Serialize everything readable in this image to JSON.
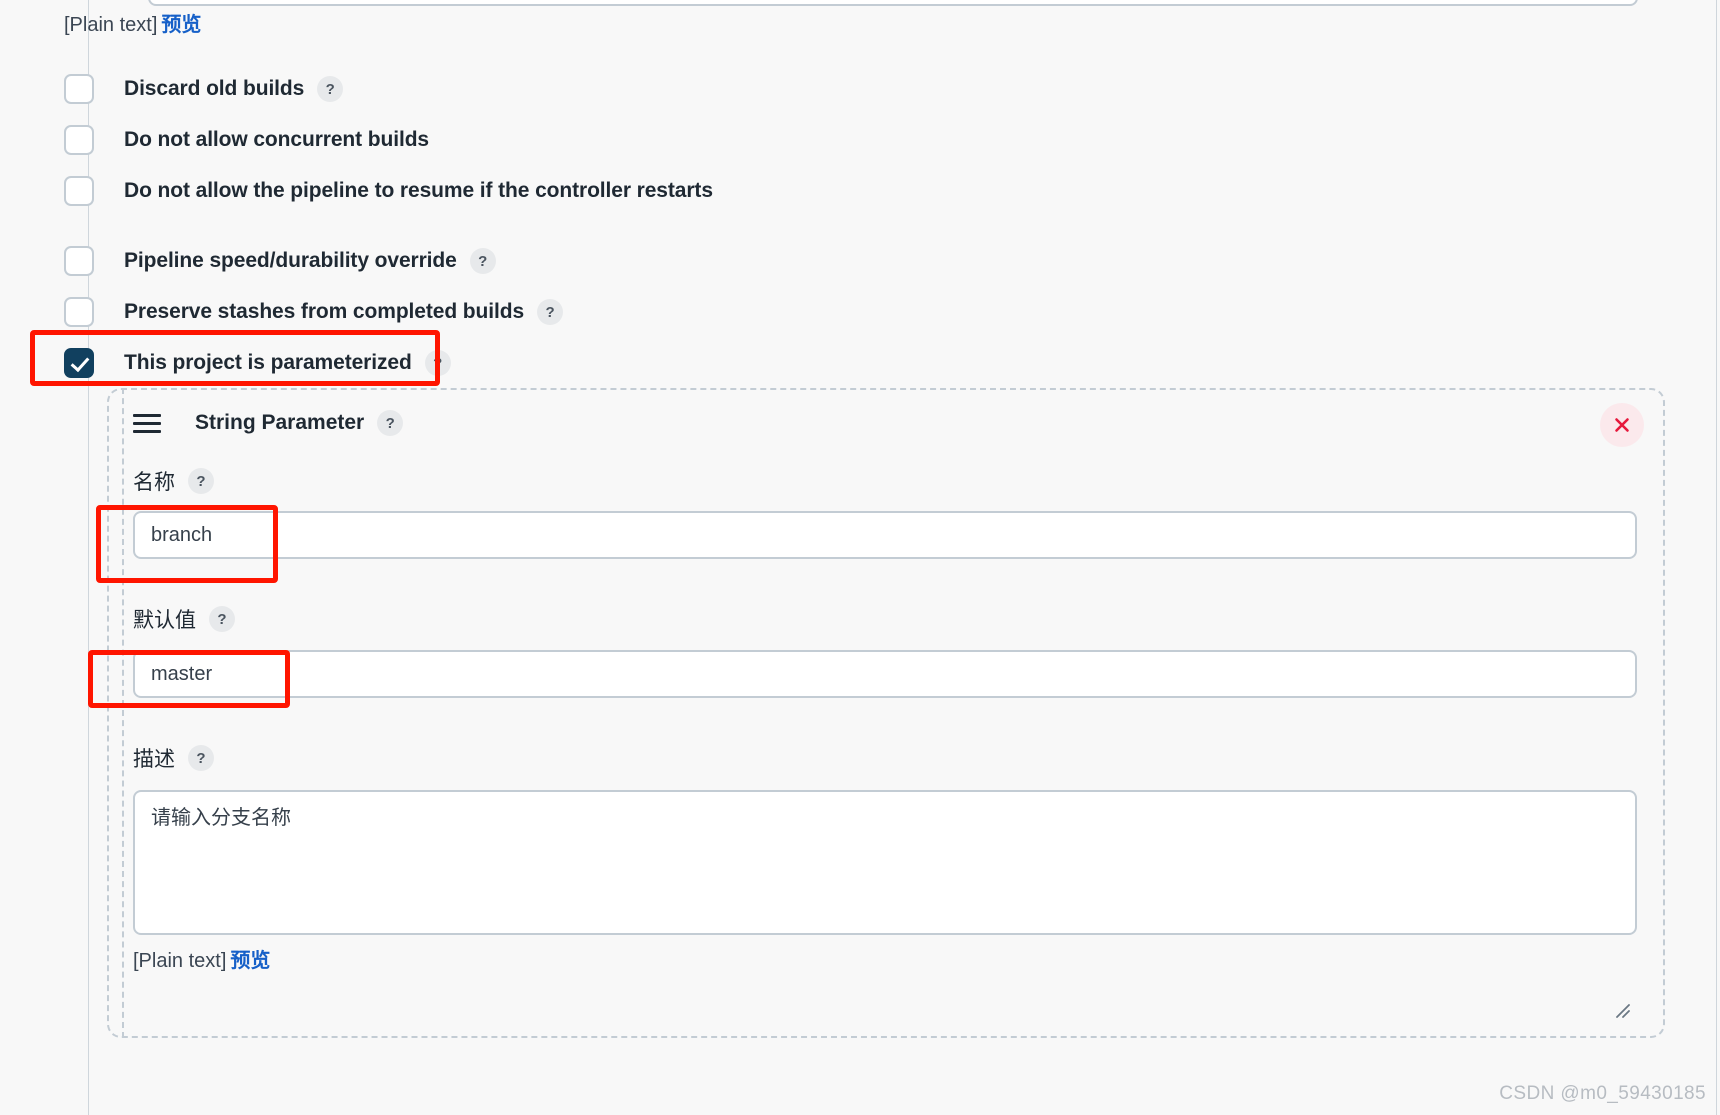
{
  "page": {
    "background_color": "#f8f8f8",
    "accent_checked_color": "#11405f",
    "link_color": "#1660c8",
    "annotation_color": "#ff1500"
  },
  "top_preview": {
    "format_label": "[Plain text]",
    "preview_link": "预览"
  },
  "options": [
    {
      "label": "Discard old builds",
      "checked": false,
      "has_help": true
    },
    {
      "label": "Do not allow concurrent builds",
      "checked": false,
      "has_help": false
    },
    {
      "label": "Do not allow the pipeline to resume if the controller restarts",
      "checked": false,
      "has_help": false
    },
    {
      "label": "Pipeline speed/durability override",
      "checked": false,
      "has_help": true
    },
    {
      "label": "Preserve stashes from completed builds",
      "checked": false,
      "has_help": true
    },
    {
      "label": "This project is parameterized",
      "checked": true,
      "has_help": true
    }
  ],
  "help_glyph": "?",
  "parameter": {
    "type_title": "String Parameter",
    "drag_handle_icon": "hamburger-drag-icon",
    "close_icon": "close-x-icon",
    "name_field": {
      "label": "名称",
      "value": "branch",
      "placeholder": ""
    },
    "default_value_field": {
      "label": "默认值",
      "value": "master",
      "placeholder": ""
    },
    "description_field": {
      "label": "描述",
      "value": "请输入分支名称",
      "placeholder": "",
      "format_label": "[Plain text]",
      "preview_link": "预览"
    }
  },
  "watermark": "CSDN @m0_59430185"
}
